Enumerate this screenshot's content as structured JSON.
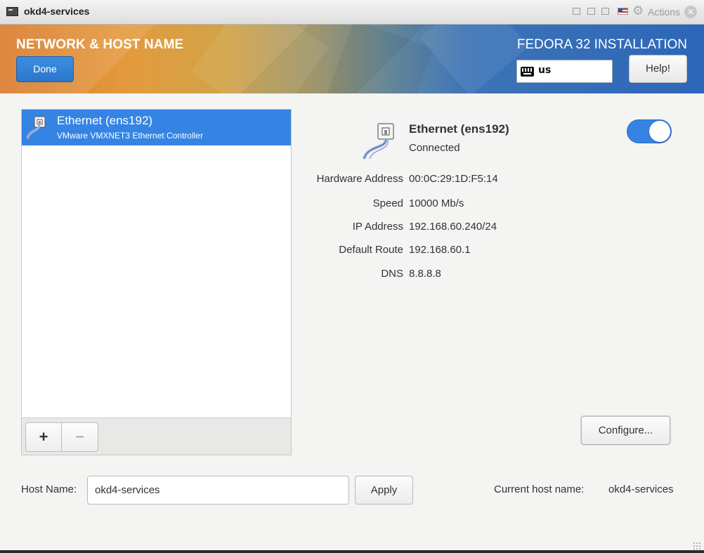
{
  "window": {
    "title": "okd4-services",
    "actions_label": "Actions"
  },
  "header": {
    "title": "NETWORK & HOST NAME",
    "done_label": "Done",
    "install_title": "FEDORA 32 INSTALLATION",
    "keyboard_layout": "us",
    "help_label": "Help!"
  },
  "devices": [
    {
      "name": "Ethernet (ens192)",
      "description": "VMware VMXNET3 Ethernet Controller",
      "selected": true
    }
  ],
  "list_toolbar": {
    "add_label": "+",
    "remove_label": "−"
  },
  "detail": {
    "name": "Ethernet (ens192)",
    "status": "Connected",
    "enabled": true,
    "properties": [
      {
        "label": "Hardware Address",
        "value": "00:0C:29:1D:F5:14"
      },
      {
        "label": "Speed",
        "value": "10000 Mb/s"
      },
      {
        "label": "IP Address",
        "value": "192.168.60.240/24"
      },
      {
        "label": "Default Route",
        "value": "192.168.60.1"
      },
      {
        "label": "DNS",
        "value": "8.8.8.8"
      }
    ],
    "configure_label": "Configure..."
  },
  "hostname": {
    "label": "Host Name:",
    "value": "okd4-services",
    "apply_label": "Apply",
    "current_label": "Current host name:",
    "current_value": "okd4-services"
  },
  "colors": {
    "accent": "#3584e4",
    "header_orange": "#d9792a",
    "header_blue": "#2c66b9"
  },
  "icons": {
    "device": "ethernet-cable-icon",
    "keyboard": "keyboard-icon",
    "settings": "gear-icon",
    "close": "close-icon"
  }
}
